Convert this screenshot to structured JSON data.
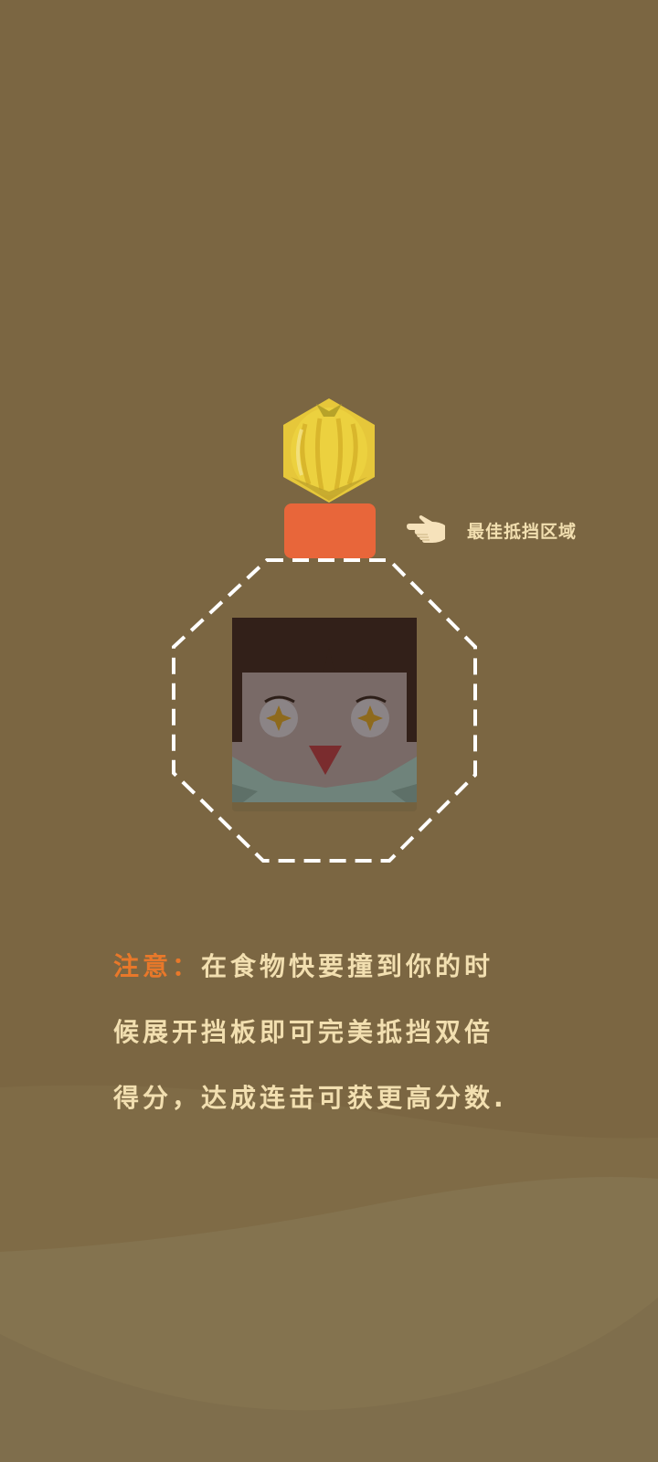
{
  "colors": {
    "background": "#7b6642",
    "wave_light": "#84734f",
    "paddle": "#e8663a",
    "text": "#f2dfb0",
    "accent": "#e8782a",
    "food": "#ecd13f"
  },
  "hint": {
    "icon": "pointing-hand-icon",
    "label": "最佳抵挡区域"
  },
  "tip": {
    "label": "注意：",
    "line1": "在食物快要撞到你的时",
    "line2": "候展开挡板即可完美抵挡双倍",
    "line3": "得分，达成连击可获更高分数."
  }
}
